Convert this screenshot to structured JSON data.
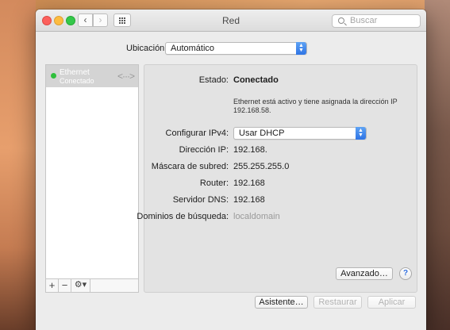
{
  "window": {
    "title": "Red",
    "search_placeholder": "Buscar"
  },
  "location": {
    "label": "Ubicación:",
    "value": "Automático"
  },
  "sidebar": {
    "items": [
      {
        "name": "Ethernet",
        "status": "Conectado",
        "status_color": "#2fbf3c"
      }
    ],
    "tools": {
      "add": "+",
      "remove": "−",
      "gear": "⚙▾"
    }
  },
  "details": {
    "status_label": "Estado:",
    "status_value": "Conectado",
    "status_description": "Ethernet está activo y tiene asignada la dirección IP 192.168.58.",
    "ipv4_label": "Configurar IPv4:",
    "ipv4_value": "Usar DHCP",
    "ip_label": "Dirección IP:",
    "ip_value": "192.168.",
    "mask_label": "Máscara de subred:",
    "mask_value": "255.255.255.0",
    "router_label": "Router:",
    "router_value": "192.168",
    "dns_label": "Servidor DNS:",
    "dns_value": "192.168",
    "search_domains_label": "Dominios de búsqueda:",
    "search_domains_value": "localdomain",
    "advanced_button": "Avanzado…",
    "help_button": "?"
  },
  "footer": {
    "assistant_button": "Asistente…",
    "revert_button": "Restaurar",
    "apply_button": "Aplicar"
  },
  "colors": {
    "close": "#fc605c",
    "minimize": "#fdbc40",
    "maximize": "#34c84a",
    "accent": "#2e74e5"
  }
}
